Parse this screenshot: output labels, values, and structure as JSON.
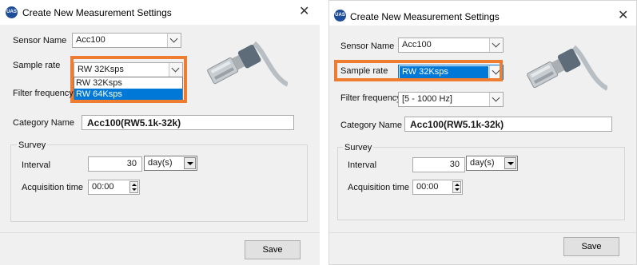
{
  "left": {
    "title": "Create New Measurement Settings",
    "app_icon_text": "UAS",
    "close_label": "✕",
    "sensor_name_label": "Sensor Name",
    "sensor_name_value": "Acc100",
    "sample_rate_label": "Sample rate",
    "sample_rate_value": "RW 32Ksps",
    "sample_rate_options": [
      "RW 32Ksps",
      "RW 64Ksps"
    ],
    "filter_frequency_label": "Filter frequency",
    "category_name_label": "Category Name",
    "category_name_value": "Acc100(RW5.1k-32k)",
    "survey_label": "Survey",
    "interval_label": "Interval",
    "interval_value": "30",
    "interval_unit": "day(s)",
    "acquisition_time_label": "Acquisition time",
    "acquisition_time_value": "00:00",
    "save_label": "Save"
  },
  "right": {
    "title": "Create New Measurement Settings",
    "app_icon_text": "UAS",
    "close_label": "✕",
    "sensor_name_label": "Sensor Name",
    "sensor_name_value": "Acc100",
    "sample_rate_label": "Sample rate",
    "sample_rate_value": "RW 32Ksps",
    "filter_frequency_label": "Filter frequency",
    "filter_frequency_value": "[5 - 1000 Hz]",
    "category_name_label": "Category Name",
    "category_name_value": "Acc100(RW5.1k-32k)",
    "survey_label": "Survey",
    "interval_label": "Interval",
    "interval_value": "30",
    "interval_unit": "day(s)",
    "acquisition_time_label": "Acquisition time",
    "acquisition_time_value": "00:00",
    "save_label": "Save"
  },
  "colors": {
    "highlight": "#ee7d31",
    "selection": "#0078d7",
    "dialog_bg": "#f0f0f0"
  },
  "icons": [
    "app-logo-icon",
    "close-icon",
    "chevron-down-icon",
    "dropdown-arrow-icon",
    "spinner-icon",
    "sensor-image"
  ]
}
